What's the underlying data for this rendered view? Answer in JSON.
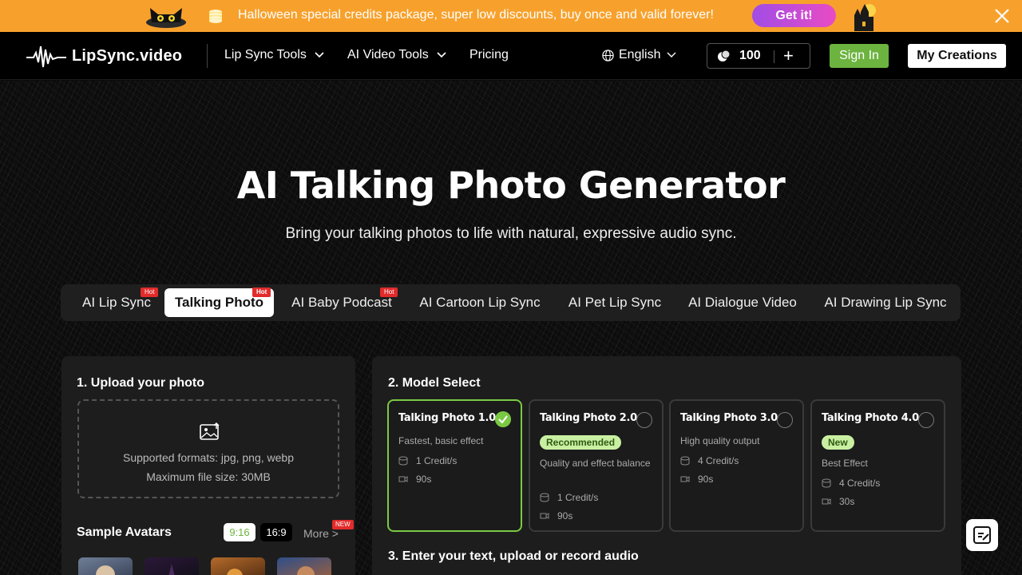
{
  "promo": {
    "text": "Halloween special credits package, super low discounts, buy once and valid forever!",
    "cta": "Get it!"
  },
  "nav": {
    "logo": "LipSync.video",
    "menu": [
      {
        "label": "Lip Sync Tools",
        "has_dropdown": true
      },
      {
        "label": "AI Video Tools",
        "has_dropdown": true
      },
      {
        "label": "Pricing",
        "has_dropdown": false
      }
    ],
    "language": "English",
    "credits": "100",
    "plus": "+",
    "sign_in": "Sign In",
    "my_creations": "My Creations"
  },
  "hero": {
    "title": "AI Talking Photo Generator",
    "subtitle": "Bring your talking photos to life with natural, expressive audio sync."
  },
  "tabs": [
    {
      "label": "AI Lip Sync",
      "badge": "Hot",
      "active": false
    },
    {
      "label": "Talking Photo",
      "badge": "Hot",
      "active": true
    },
    {
      "label": "AI Baby Podcast",
      "badge": "Hot",
      "active": false
    },
    {
      "label": "AI Cartoon Lip Sync",
      "badge": "",
      "active": false
    },
    {
      "label": "AI Pet Lip Sync",
      "badge": "",
      "active": false
    },
    {
      "label": "AI Dialogue Video",
      "badge": "",
      "active": false
    },
    {
      "label": "AI Drawing Lip Sync",
      "badge": "",
      "active": false
    }
  ],
  "upload": {
    "title": "1. Upload your photo",
    "formats": "Supported formats: jpg, png, webp",
    "max_size": "Maximum file size: 30MB"
  },
  "avatars": {
    "title": "Sample Avatars",
    "ratio_a": "9:16",
    "ratio_b": "16:9",
    "more": "More >",
    "new_badge": "NEW"
  },
  "models": {
    "title": "2. Model Select",
    "cards": [
      {
        "name": "Talking Photo 1.0",
        "badge": "",
        "desc": "Fastest, basic effect",
        "credits": "1 Credit/s",
        "duration": "90s",
        "selected": true
      },
      {
        "name": "Talking Photo 2.0",
        "badge": "Recommended",
        "desc": "Quality and effect balance",
        "credits": "1 Credit/s",
        "duration": "90s",
        "selected": false
      },
      {
        "name": "Talking Photo 3.0",
        "badge": "",
        "desc": "High quality output",
        "credits": "4 Credit/s",
        "duration": "90s",
        "selected": false
      },
      {
        "name": "Talking Photo 4.0",
        "badge": "New",
        "desc": "Best Effect",
        "credits": "4 Credit/s",
        "duration": "30s",
        "selected": false
      }
    ]
  },
  "audio": {
    "title": "3. Enter your text, upload or record audio"
  },
  "colors": {
    "promo_bg": "#f7a12c",
    "accent_green": "#7ac943",
    "sign_in_green": "#6cb33f",
    "hot_red": "#e22b2b"
  }
}
